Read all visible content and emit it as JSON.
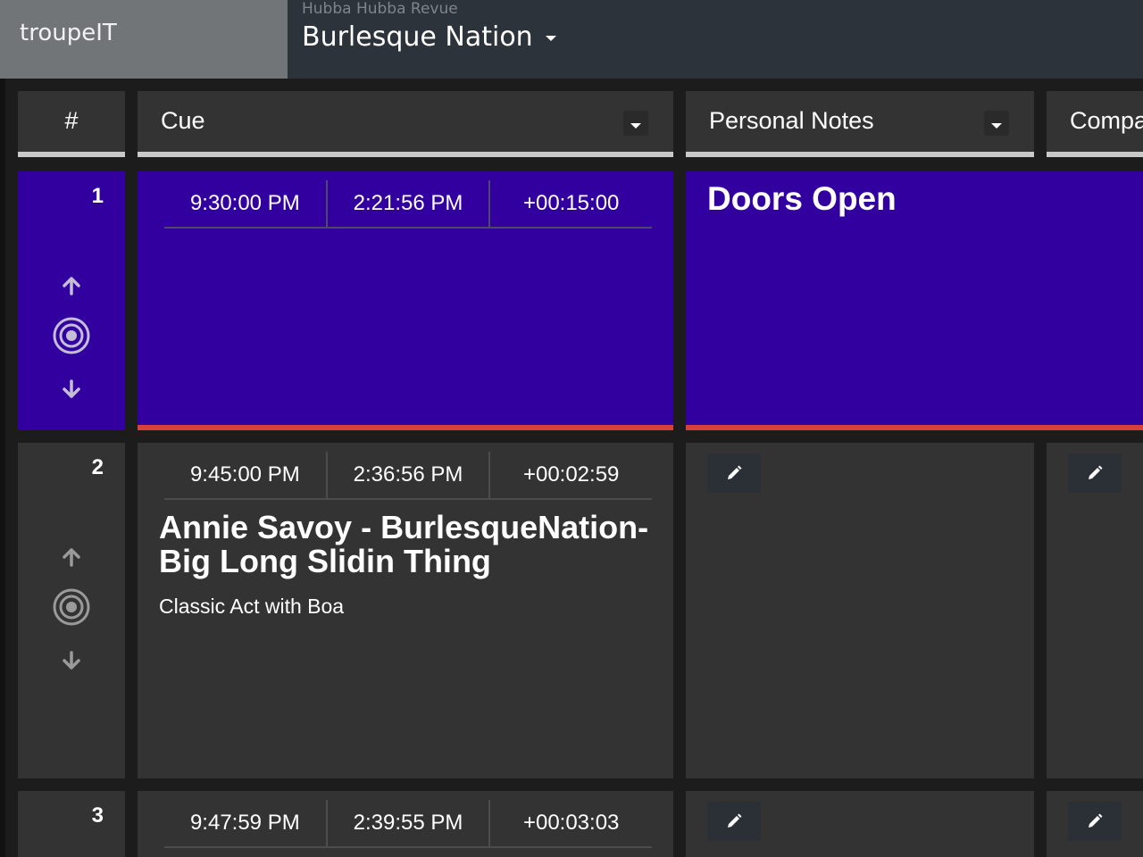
{
  "header": {
    "brand": "troupeIT",
    "subtitle": "Hubba Hubba Revue",
    "show_name": "Burlesque Nation"
  },
  "columns": {
    "number": "#",
    "cue": "Cue",
    "notes": "Personal Notes",
    "company": "Compa"
  },
  "rows": [
    {
      "number": "1",
      "start": "9:30:00 PM",
      "clock": "2:21:56 PM",
      "duration": "+00:15:00",
      "note": "Doors Open",
      "active": true
    },
    {
      "number": "2",
      "start": "9:45:00 PM",
      "clock": "2:36:56 PM",
      "duration": "+00:02:59",
      "title": "Annie Savoy - BurlesqueNation-Big Long Slidin Thing",
      "description": "Classic Act with Boa"
    },
    {
      "number": "3",
      "start": "9:47:59 PM",
      "clock": "2:39:55 PM",
      "duration": "+00:03:03"
    }
  ],
  "colors": {
    "active_row": "#3300a0",
    "active_bottom": "#d9403c",
    "panel": "#333333",
    "brand_bg": "#717578",
    "topbar_bg": "#2d333a"
  },
  "icons": {
    "up": "arrow-up-icon",
    "down": "arrow-down-icon",
    "target": "target-icon",
    "edit": "pencil-icon",
    "dropdown": "caret-down-icon"
  }
}
